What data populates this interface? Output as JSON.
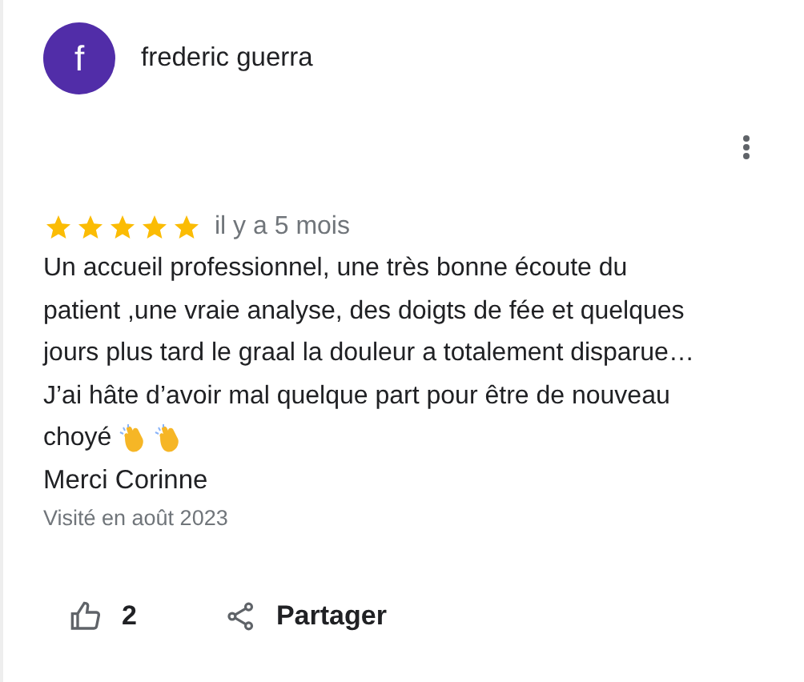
{
  "reviewer": {
    "initial": "f",
    "name": "frederic guerra"
  },
  "rating": {
    "stars": 5,
    "time": "il y a 5 mois"
  },
  "review_lines": [
    "Un accueil professionnel, une très bonne écoute du",
    "patient ,une vraie analyse, des doigts de fée et quelques",
    "jours plus tard le graal la douleur a totalement disparue…",
    "J’ai hâte d’avoir mal quelque part pour être de nouveau",
    "choyé"
  ],
  "signature": "Merci Corinne",
  "visited": "Visité en août 2023",
  "actions": {
    "likes": "2",
    "share": "Partager"
  }
}
